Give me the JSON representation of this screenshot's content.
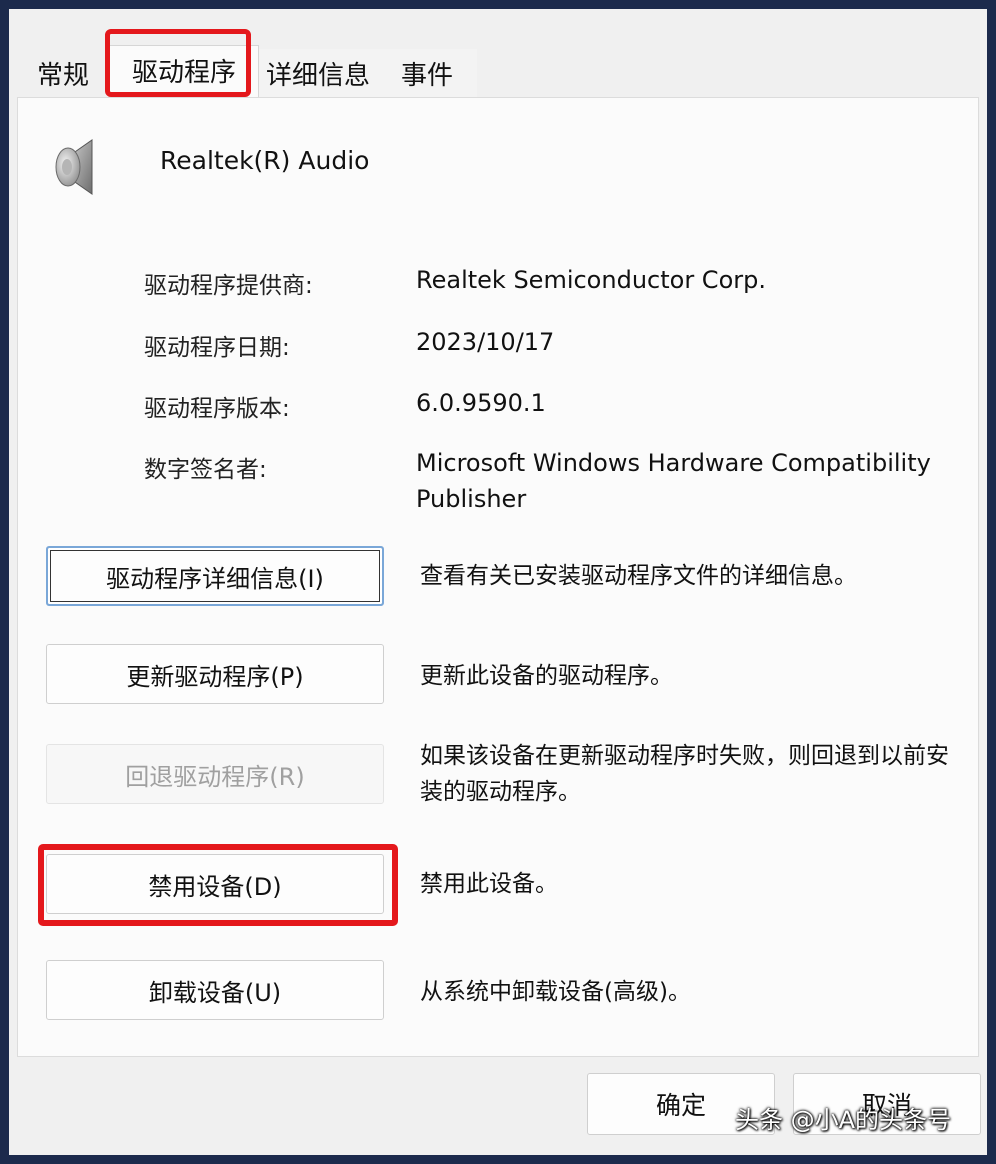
{
  "tabs": {
    "general": "常规",
    "driver": "驱动程序",
    "details": "详细信息",
    "events": "事件"
  },
  "device": {
    "icon": "speaker-icon",
    "name": "Realtek(R) Audio"
  },
  "driver_info": {
    "provider_label": "驱动程序提供商:",
    "provider_value": "Realtek Semiconductor Corp.",
    "date_label": "驱动程序日期:",
    "date_value": "2023/10/17",
    "version_label": "驱动程序版本:",
    "version_value": "6.0.9590.1",
    "signer_label": "数字签名者:",
    "signer_value": "Microsoft Windows Hardware Compatibility Publisher"
  },
  "actions": {
    "details_button": "驱动程序详细信息(I)",
    "details_desc": "查看有关已安装驱动程序文件的详细信息。",
    "update_button": "更新驱动程序(P)",
    "update_desc": "更新此设备的驱动程序。",
    "rollback_button": "回退驱动程序(R)",
    "rollback_desc": "如果该设备在更新驱动程序时失败，则回退到以前安装的驱动程序。",
    "disable_button": "禁用设备(D)",
    "disable_desc": "禁用此设备。",
    "uninstall_button": "卸载设备(U)",
    "uninstall_desc": "从系统中卸载设备(高级)。"
  },
  "footer": {
    "ok": "确定",
    "cancel": "取消"
  },
  "watermark": "头条 @小A的头条号",
  "colors": {
    "highlight": "#e4181c",
    "dialog_bg": "#f0f0f0",
    "panel_bg": "#fbfbfb"
  }
}
